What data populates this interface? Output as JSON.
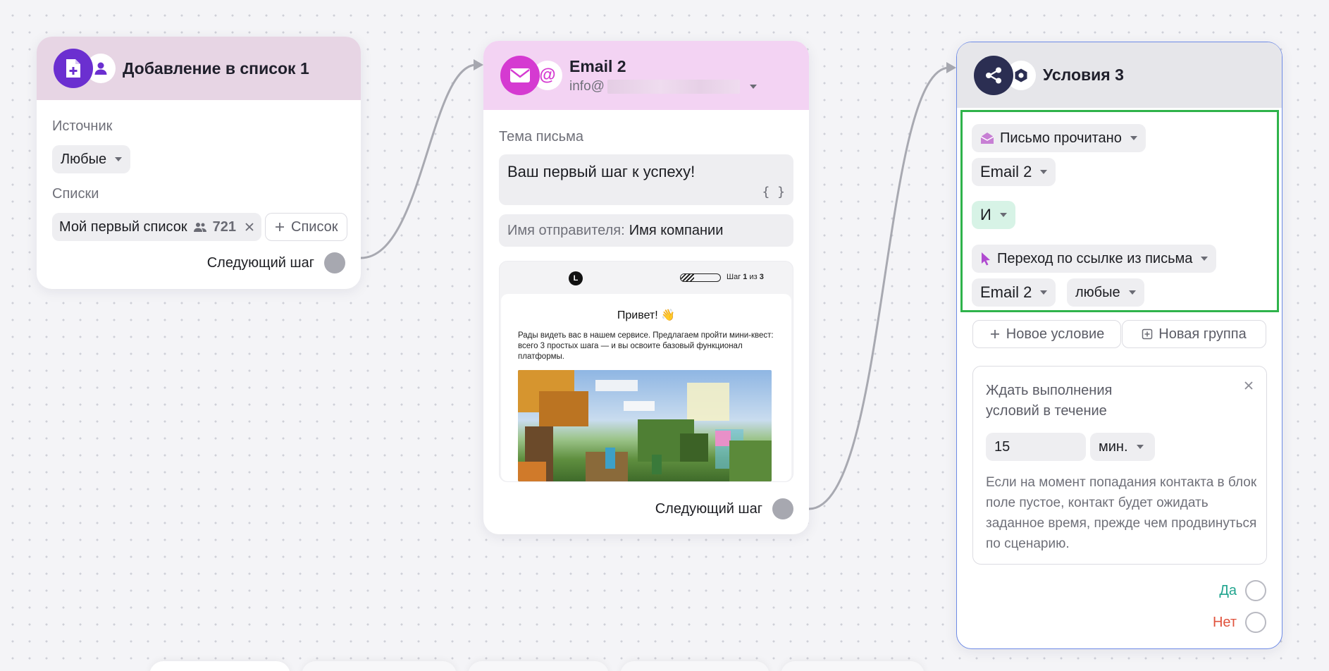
{
  "colors": {
    "accent_purple": "#6b2fd0",
    "email_magenta": "#d53ad1",
    "conditions_navy": "#2b2e52",
    "condition_border": "#2fb34b",
    "selected_border": "#6e8be6",
    "yes": "#22a58f",
    "no": "#e0533d"
  },
  "node_list": {
    "title": "Добавление в список 1",
    "source_label": "Источник",
    "source_value": "Любые",
    "lists_label": "Списки",
    "list_name": "Мой первый список",
    "list_count": "721",
    "add_list": "Список",
    "next_step": "Следующий шаг",
    "icons": [
      "add-file-icon",
      "user-icon"
    ]
  },
  "node_email": {
    "title": "Email 2",
    "sender_address": "info@",
    "subject_label": "Тема письма",
    "subject_value": "Ваш первый шаг к успеху!",
    "variables_glyph": "{ }",
    "sender_name_label": "Имя отправителя:",
    "sender_name_value": "Имя компании",
    "preview": {
      "logo_letter": "L",
      "step_prefix": "Шаг ",
      "step_current": "1",
      "step_mid": " из ",
      "step_total": "3",
      "greeting": "Привет! 👋",
      "body": "Рады видеть вас в нашем сервисе. Предлагаем пройти мини-квест: всего 3 простых шага — и вы освоите базовый функционал платформы."
    },
    "next_step": "Следующий шаг",
    "icons": [
      "envelope-icon",
      "at-icon"
    ]
  },
  "node_conditions": {
    "title": "Условия 3",
    "cond1_event": "Письмо прочитано",
    "cond1_email": "Email 2",
    "operator": "И",
    "cond2_event": "Переход по ссылке из письма",
    "cond2_email": "Email 2",
    "cond2_link": "любые",
    "new_condition": "Новое условие",
    "new_group": "Новая группа",
    "wait_title": "Ждать выполнения условий в течение",
    "wait_value": "15",
    "wait_unit": "мин.",
    "wait_hint": "Если на момент попадания контакта в блок поле пустое, контакт будет ожидать заданное время, прежде чем продвинуться по сценарию.",
    "yes_label": "Да",
    "no_label": "Нет",
    "icons": [
      "share-nodes-icon",
      "hexagon-settings-icon"
    ]
  }
}
